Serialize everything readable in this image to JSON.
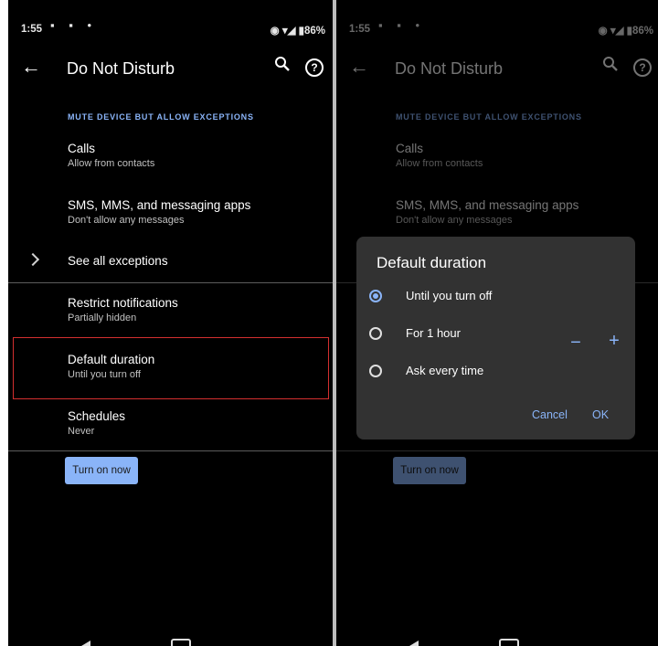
{
  "status_bar": {
    "time": "1:55",
    "battery": "86%",
    "left_icons": [
      "image-icon",
      "game-icon",
      "dot-icon"
    ],
    "right_icons": [
      "vibrate-icon",
      "wifi-icon",
      "signal-icon",
      "battery-icon"
    ]
  },
  "app_bar": {
    "title": "Do Not Disturb"
  },
  "settings": {
    "section_header": "MUTE DEVICE BUT ALLOW EXCEPTIONS",
    "calls": {
      "title": "Calls",
      "subtitle": "Allow from contacts"
    },
    "messages": {
      "title": "SMS, MMS, and messaging apps",
      "subtitle": "Don't allow any messages"
    },
    "see_all": {
      "title": "See all exceptions"
    },
    "restrict": {
      "title": "Restrict notifications",
      "subtitle": "Partially hidden"
    },
    "default_duration": {
      "title": "Default duration",
      "subtitle": "Until you turn off"
    },
    "schedules": {
      "title": "Schedules",
      "subtitle": "Never"
    },
    "turn_on_label": "Turn on now"
  },
  "dialog": {
    "title": "Default duration",
    "options": [
      {
        "label": "Until you turn off",
        "selected": true
      },
      {
        "label": "For 1 hour",
        "selected": false
      },
      {
        "label": "Ask every time",
        "selected": false
      }
    ],
    "stepper_minus": "−",
    "stepper_plus": "+",
    "cancel_label": "Cancel",
    "ok_label": "OK"
  },
  "colors": {
    "accent": "#8ab4f8",
    "highlight": "#d32f2f",
    "background": "#000000",
    "dialog": "#323232"
  }
}
